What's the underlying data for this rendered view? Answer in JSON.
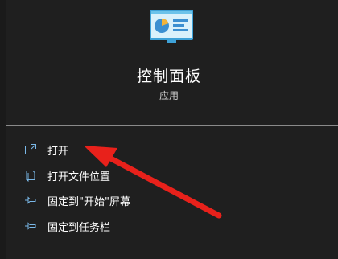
{
  "app": {
    "title": "控制面板",
    "type_label": "应用",
    "icon": "control-panel-icon"
  },
  "menu": {
    "items": [
      {
        "label": "打开",
        "icon": "open-window-icon"
      },
      {
        "label": "打开文件位置",
        "icon": "file-location-icon"
      },
      {
        "label": "固定到\"开始\"屏幕",
        "icon": "pin-icon"
      },
      {
        "label": "固定到任务栏",
        "icon": "pin-icon"
      }
    ]
  },
  "colors": {
    "background": "#1f1f1f",
    "annotation_arrow": "#e8211b",
    "icon_accent": "#7ab8e8"
  }
}
